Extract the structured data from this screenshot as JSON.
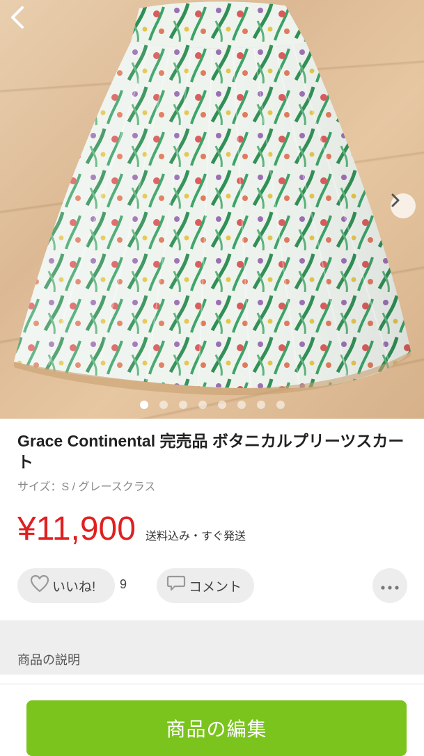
{
  "product": {
    "title": "Grace Continental 完売品 ボタニカルプリーツスカート",
    "subtitle": "サイズ：S / グレースクラス",
    "price": "¥11,900",
    "shipping_note": "送料込み・すぐ発送"
  },
  "gallery": {
    "image_count": 8,
    "active_index": 0
  },
  "actions": {
    "like_label": "いいね!",
    "like_count": "9",
    "comment_label": "コメント"
  },
  "section": {
    "description_label": "商品の説明"
  },
  "footer": {
    "edit_label": "商品の編集"
  },
  "colors": {
    "price": "#e02020",
    "primary_button": "#7ac41d"
  },
  "icons": [
    "chevron-left-icon",
    "chevron-right-icon",
    "heart-icon",
    "speech-bubble-icon",
    "more-dots-icon"
  ]
}
